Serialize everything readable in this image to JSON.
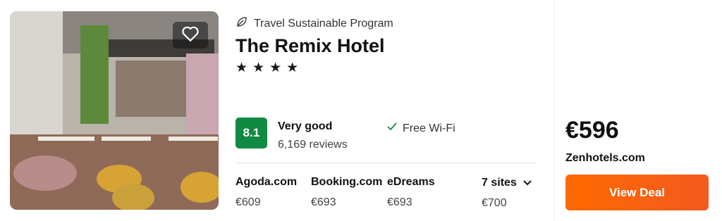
{
  "hotel": {
    "sustainability_label": "Travel Sustainable Program",
    "sustainability_icon": "leaf-icon",
    "name": "The Remix Hotel",
    "stars": 4,
    "favorite_icon": "heart-icon"
  },
  "rating": {
    "score": "8.1",
    "label": "Very good",
    "reviews": "6,169 reviews",
    "badge_color": "#108a42"
  },
  "amenities": [
    {
      "icon": "check-icon",
      "label": "Free Wi-Fi"
    }
  ],
  "other_sites": [
    {
      "name": "Agoda.com",
      "price": "€609"
    },
    {
      "name": "Booking.com",
      "price": "€693"
    },
    {
      "name": "eDreams",
      "price": "€693"
    }
  ],
  "more_sites": {
    "label": "7 sites",
    "price": "€700",
    "icon": "chevron-down-icon"
  },
  "deal": {
    "price": "€596",
    "provider": "Zenhotels.com",
    "button_label": "View Deal",
    "button_color": "#ff6a00"
  }
}
